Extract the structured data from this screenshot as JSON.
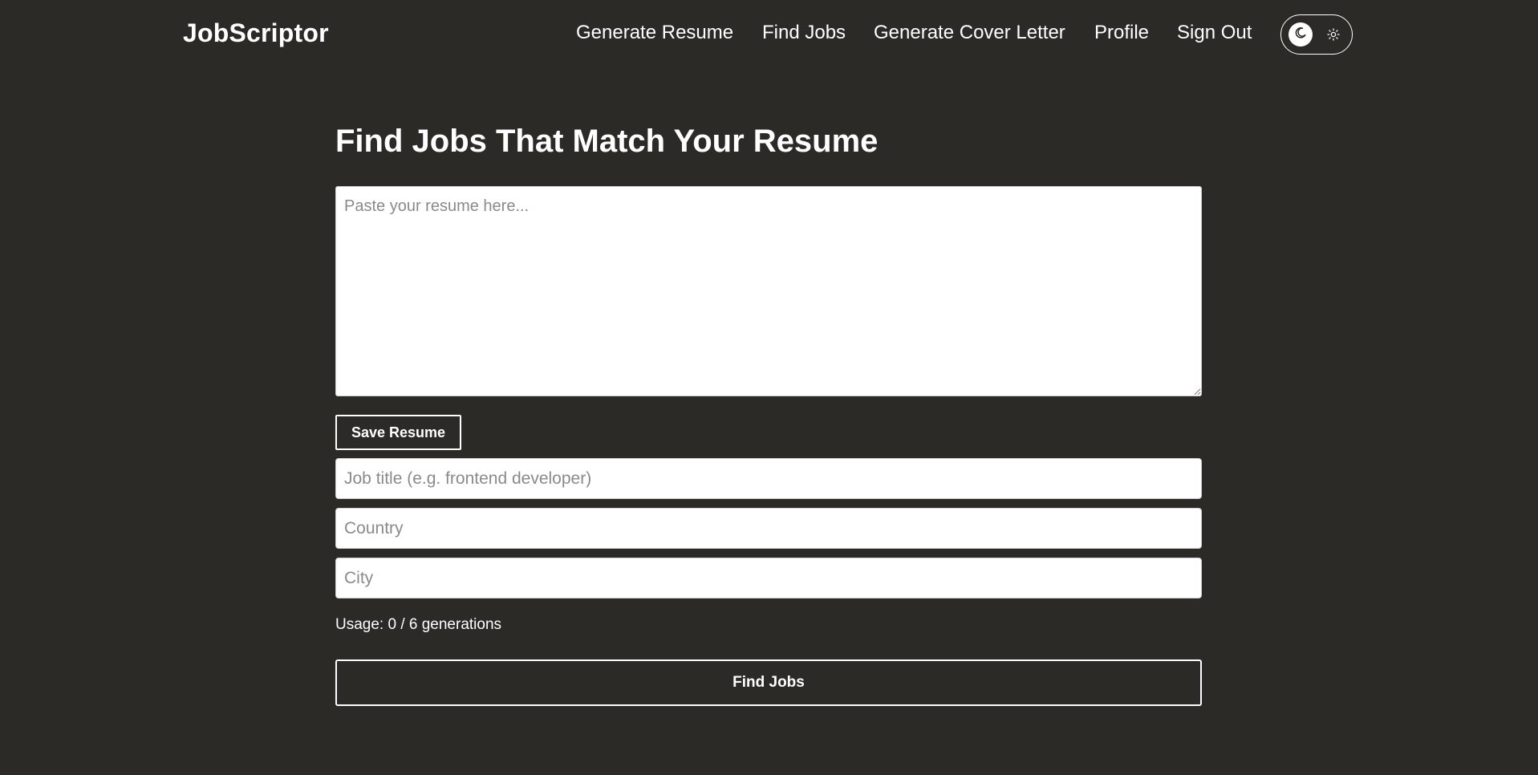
{
  "header": {
    "logo": "JobScriptor",
    "nav": [
      {
        "label": "Generate Resume"
      },
      {
        "label": "Find Jobs"
      },
      {
        "label": "Generate Cover Letter"
      },
      {
        "label": "Profile"
      },
      {
        "label": "Sign Out"
      }
    ],
    "theme_toggle": {
      "mode": "dark",
      "icons": [
        "moon-icon",
        "sun-icon"
      ]
    }
  },
  "main": {
    "title": "Find Jobs That Match Your Resume",
    "resume": {
      "value": "",
      "placeholder": "Paste your resume here..."
    },
    "save_label": "Save Resume",
    "job_title": {
      "value": "",
      "placeholder": "Job title (e.g. frontend developer)"
    },
    "country": {
      "value": "",
      "placeholder": "Country"
    },
    "city": {
      "value": "",
      "placeholder": "City"
    },
    "usage": "Usage: 0 / 6 generations",
    "find_label": "Find Jobs"
  },
  "colors": {
    "background": "#2c2a26",
    "text": "#ffffff",
    "input_background": "#ffffff",
    "placeholder": "#8a8a8a"
  }
}
